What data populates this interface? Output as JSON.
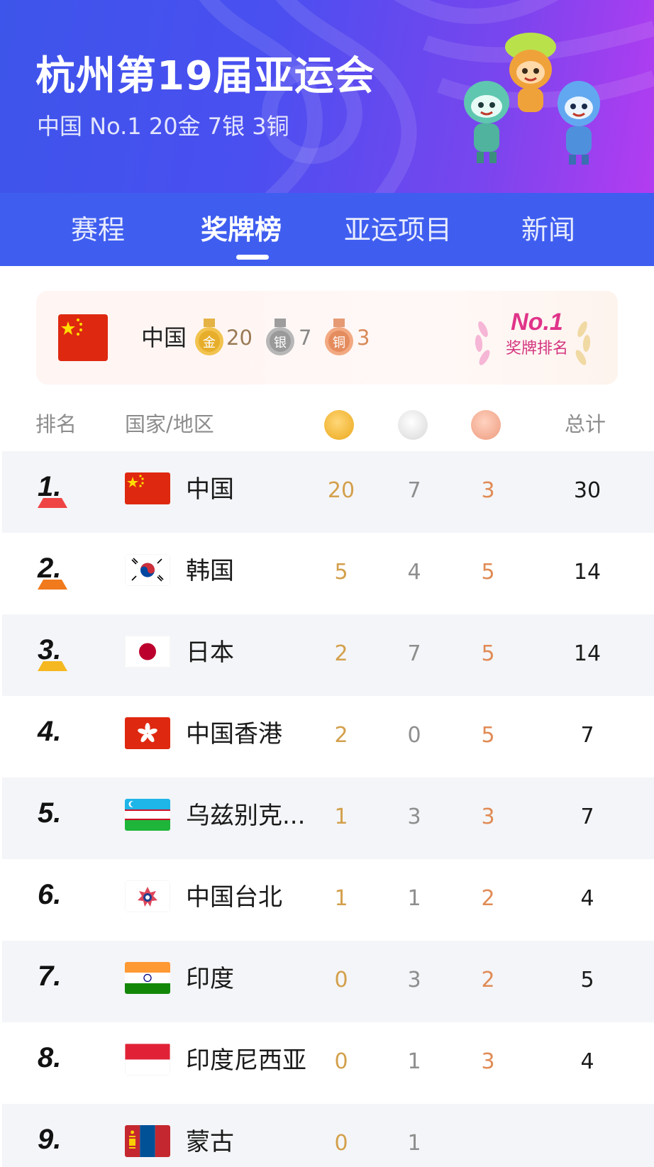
{
  "header": {
    "title": "杭州第19届亚运会",
    "subtitle": "中国 No.1 20金 7银 3铜"
  },
  "tabs": [
    {
      "label": "赛程",
      "active": false
    },
    {
      "label": "奖牌榜",
      "active": true
    },
    {
      "label": "亚运项目",
      "active": false
    },
    {
      "label": "新闻",
      "active": false
    }
  ],
  "summary": {
    "country": "中国",
    "gold_label": "金",
    "gold": "20",
    "silver_label": "银",
    "silver": "7",
    "bronze_label": "铜",
    "bronze": "3",
    "badge_title": "No.1",
    "badge_label": "奖牌排名"
  },
  "table_header": {
    "rank": "排名",
    "country": "国家/地区",
    "total": "总计"
  },
  "colors": {
    "accent_blue": "#3f5ef0",
    "gold": "#d3a04c",
    "silver": "#8e8e8e",
    "bronze": "#e08b55",
    "rank1": "#ef4444",
    "rank2": "#f07a1c",
    "rank3": "#f5b820"
  },
  "rows": [
    {
      "rank": "1.",
      "country": "中国",
      "flag": "china-flag-icon",
      "gold": "20",
      "silver": "7",
      "bronze": "3",
      "total": "30"
    },
    {
      "rank": "2.",
      "country": "韩国",
      "flag": "south-korea-flag-icon",
      "gold": "5",
      "silver": "4",
      "bronze": "5",
      "total": "14"
    },
    {
      "rank": "3.",
      "country": "日本",
      "flag": "japan-flag-icon",
      "gold": "2",
      "silver": "7",
      "bronze": "5",
      "total": "14"
    },
    {
      "rank": "4.",
      "country": "中国香港",
      "flag": "hong-kong-flag-icon",
      "gold": "2",
      "silver": "0",
      "bronze": "5",
      "total": "7"
    },
    {
      "rank": "5.",
      "country": "乌兹别克...",
      "flag": "uzbekistan-flag-icon",
      "gold": "1",
      "silver": "3",
      "bronze": "3",
      "total": "7"
    },
    {
      "rank": "6.",
      "country": "中国台北",
      "flag": "chinese-taipei-flag-icon",
      "gold": "1",
      "silver": "1",
      "bronze": "2",
      "total": "4"
    },
    {
      "rank": "7.",
      "country": "印度",
      "flag": "india-flag-icon",
      "gold": "0",
      "silver": "3",
      "bronze": "2",
      "total": "5"
    },
    {
      "rank": "8.",
      "country": "印度尼西亚",
      "flag": "indonesia-flag-icon",
      "gold": "0",
      "silver": "1",
      "bronze": "3",
      "total": "4"
    },
    {
      "rank": "9.",
      "country": "蒙古",
      "flag": "mongolia-flag-icon",
      "gold": "0",
      "silver": "1",
      "bronze": "",
      "total": ""
    }
  ]
}
